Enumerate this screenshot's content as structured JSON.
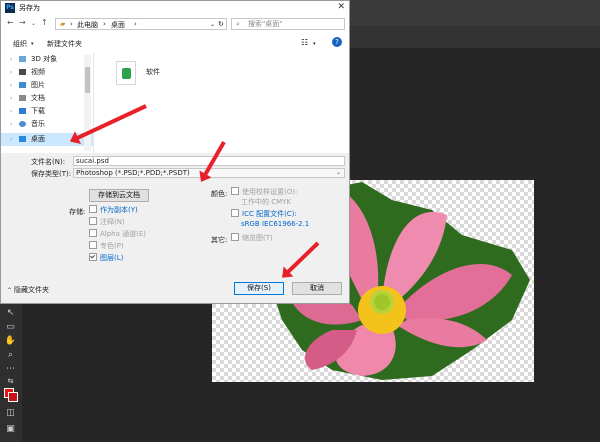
{
  "window": {
    "title": "另存为"
  },
  "address": {
    "crumbs": [
      "此电脑",
      "桌面"
    ],
    "search_placeholder": "搜索\"桌面\""
  },
  "toolbar": {
    "organize": "组织",
    "new_folder": "新建文件夹"
  },
  "nav_items": [
    {
      "label": "3D 对象"
    },
    {
      "label": "视频"
    },
    {
      "label": "图片"
    },
    {
      "label": "文档"
    },
    {
      "label": "下载"
    },
    {
      "label": "音乐"
    },
    {
      "label": "桌面"
    }
  ],
  "files": [
    {
      "label": "软件"
    }
  ],
  "form": {
    "filename_label": "文件名(N):",
    "filename_value": "sucai.psd",
    "filetype_label": "保存类型(T):",
    "filetype_value": "Photoshop (*.PSD;*.PDD;*.PSDT)"
  },
  "cloud_button": "存储到云文档",
  "storage": {
    "label": "存储:",
    "options": [
      {
        "label": "作为副本(Y)",
        "checked": false,
        "enabled": true
      },
      {
        "label": "注释(N)",
        "checked": false,
        "enabled": false
      },
      {
        "label": "Alpha 通道(E)",
        "checked": false,
        "enabled": false
      },
      {
        "label": "专色(P)",
        "checked": false,
        "enabled": false
      },
      {
        "label": "图层(L)",
        "checked": true,
        "enabled": true
      }
    ]
  },
  "color": {
    "label": "颜色:",
    "proof_line1": "使用校样设置(O):",
    "proof_line2": "工作中的 CMYK",
    "icc_line1": "ICC 配置文件(C):",
    "icc_line2": "sRGB IEC61966-2.1"
  },
  "other": {
    "label": "其它:",
    "thumbnail": "缩览图(T)"
  },
  "hide_folders": "隐藏文件夹",
  "buttons": {
    "save": "保存(S)",
    "cancel": "取消"
  },
  "colors": {
    "accent": "#0078d7",
    "arrow": "#e8202a",
    "selected": "#cce8ff"
  }
}
